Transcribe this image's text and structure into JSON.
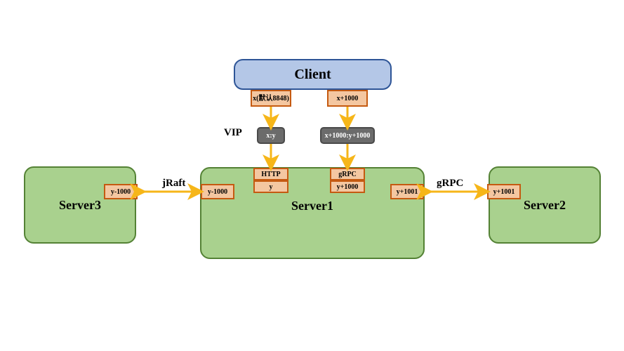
{
  "client": {
    "label": "Client"
  },
  "server1": {
    "label": "Server1"
  },
  "server2": {
    "label": "Server2"
  },
  "server3": {
    "label": "Server3"
  },
  "client_ports": {
    "left": "x(默认8848)",
    "right": "x+1000"
  },
  "vip": {
    "label": "VIP",
    "left": "x:y",
    "right": "x+1000:y+1000"
  },
  "server1_ports": {
    "http_top": "HTTP",
    "http_bottom": "y",
    "grpc_top": "gRPC",
    "grpc_bottom": "y+1000",
    "left": "y-1000",
    "right": "y+1001"
  },
  "server3_ports": {
    "right": "y-1000"
  },
  "server2_ports": {
    "left": "y+1001"
  },
  "edges": {
    "jraft": "jRaft",
    "grpc": "gRPC"
  },
  "colors": {
    "green_fill": "#a9d18e",
    "green_border": "#548235",
    "blue_fill": "#b4c7e7",
    "blue_border": "#2e5597",
    "port_fill": "#f4c7a1",
    "port_border": "#c55a11",
    "vip_fill": "#6b6b6b",
    "arrow": "#f6b619"
  }
}
